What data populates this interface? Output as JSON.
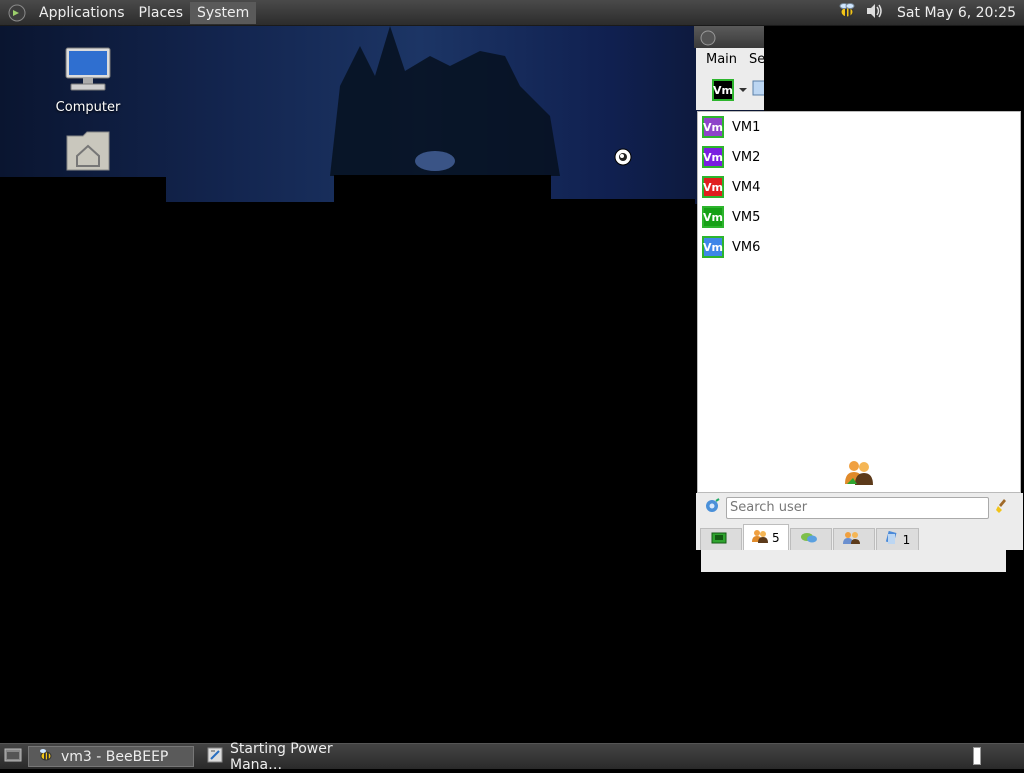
{
  "top_panel": {
    "menus": [
      "Applications",
      "Places",
      "System"
    ],
    "clock": "Sat May  6, 20:25"
  },
  "desktop": {
    "icons": [
      {
        "label": "Computer",
        "icon": "computer-icon"
      },
      {
        "label": "",
        "icon": "home-folder-icon"
      }
    ]
  },
  "window": {
    "menus": [
      "Main",
      "Se"
    ],
    "toolbar_badge": "Vm",
    "users": [
      {
        "badge": "Vm",
        "name": "VM1",
        "color": "#8e44c9"
      },
      {
        "badge": "Vm",
        "name": "VM2",
        "color": "#7a1ee0"
      },
      {
        "badge": "Vm",
        "name": "VM4",
        "color": "#e01e1e"
      },
      {
        "badge": "Vm",
        "name": "VM5",
        "color": "#16a016"
      },
      {
        "badge": "Vm",
        "name": "VM6",
        "color": "#3e86e8"
      }
    ],
    "search_placeholder": "Search user",
    "tabs": [
      {
        "icon": "screen-icon",
        "count": ""
      },
      {
        "icon": "users-icon",
        "count": "5"
      },
      {
        "icon": "chat-icon",
        "count": ""
      },
      {
        "icon": "groups-icon",
        "count": ""
      },
      {
        "icon": "files-icon",
        "count": "1"
      }
    ]
  },
  "taskbar": {
    "tasks": [
      {
        "label": "vm3 - BeeBEEP",
        "icon": "bee-icon",
        "active": true
      },
      {
        "label": "Starting Power Mana…",
        "icon": "power-manager-icon",
        "active": false
      }
    ]
  },
  "colors": {
    "panel": "#3a3a3a",
    "window_bg": "#ececec",
    "badge_border": "#2db52d"
  }
}
